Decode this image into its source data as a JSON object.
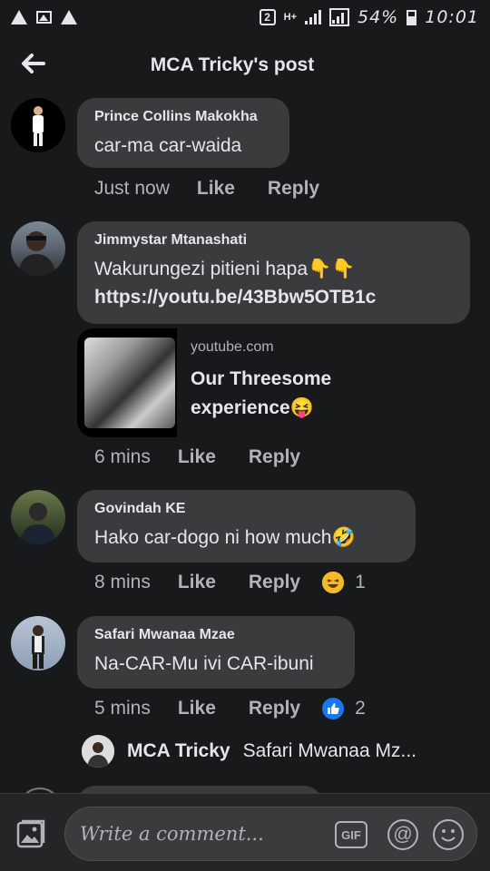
{
  "status_bar": {
    "sim_label": "2",
    "network_label": "H+",
    "battery_text": "54%",
    "time": "10:01"
  },
  "header": {
    "title": "MCA Tricky's post"
  },
  "comments": [
    {
      "author": "Prince Collins Makokha",
      "text": "car-ma car-waida",
      "time": "Just now",
      "like": "Like",
      "reply": "Reply"
    },
    {
      "author": "Jimmystar Mtanashati",
      "text_before": "Wakurungezi pitieni hapa",
      "emoji_1": "👇",
      "emoji_2": "👇",
      "link": "https://youtu.be/43Bbw5OTB1c",
      "link_preview": {
        "domain": "youtube.com",
        "title": "Our Threesome experience",
        "title_emoji": "😝"
      },
      "time": "6 mins",
      "like": "Like",
      "reply": "Reply"
    },
    {
      "author": "Govindah KE",
      "text": "Hako car-dogo ni how much",
      "text_emoji": "🤣",
      "time": "8 mins",
      "like": "Like",
      "reply": "Reply",
      "reaction": {
        "icon": "haha-emoji-icon",
        "count": "1"
      }
    },
    {
      "author": "Safari Mwanaa Mzae",
      "text": "Na-CAR-Mu ivi CAR-ibuni",
      "time": "5 mins",
      "like": "Like",
      "reply": "Reply",
      "reaction": {
        "icon": "like-reaction-icon",
        "count": "2"
      }
    }
  ],
  "reply_preview": {
    "author": "MCA Tricky",
    "snippet": "Safari Mwanaa Mz..."
  },
  "composer": {
    "placeholder": "Write a comment...",
    "gif_label": "GIF",
    "mention_label": "@"
  },
  "colors": {
    "background": "#18191a",
    "bubble": "#3a3b3c",
    "text": "#e4e6eb",
    "secondary": "#b0b3b8",
    "like_blue": "#1877f2",
    "emoji_yellow": "#f7b928"
  }
}
